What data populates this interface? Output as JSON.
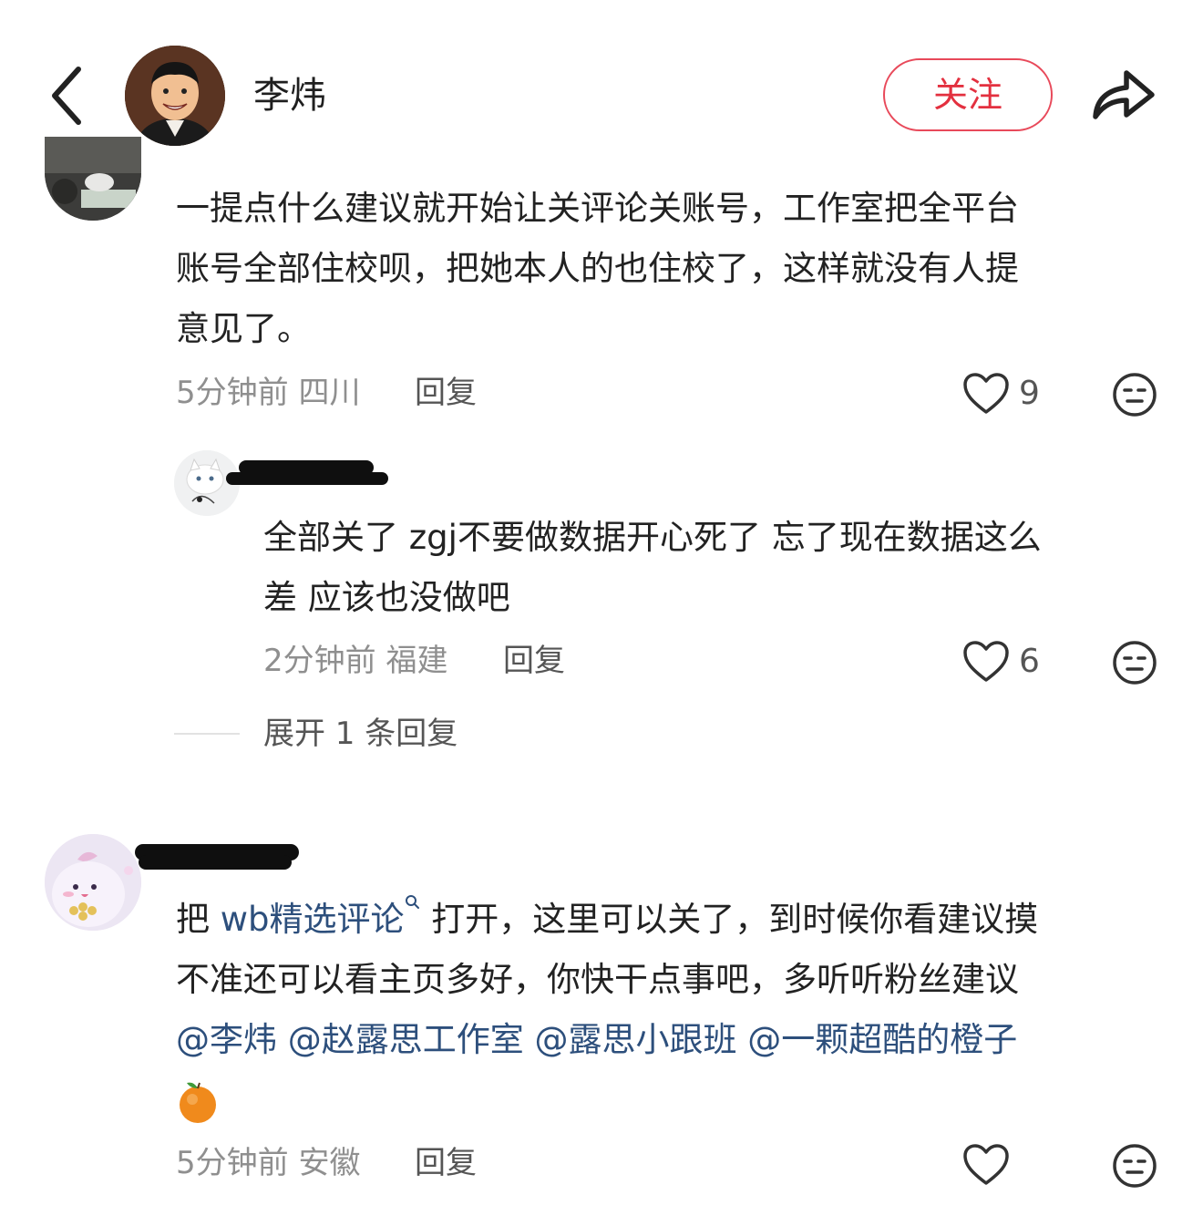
{
  "header": {
    "author_name": "李炜",
    "follow_label": "关注"
  },
  "comments": [
    {
      "text_lines": [
        "一提点什么建议就开始让关评论关账号，工作室把全平台",
        "账号全部住校呗，把她本人的也住校了，这样就没有人提",
        "意见了。"
      ],
      "time": "5分钟前",
      "location": "四川",
      "reply_label": "回复",
      "likes": "9",
      "reply": {
        "text_lines": [
          "全部关了 zgj不要做数据开心死了 忘了现在数据这么",
          "差 应该也没做吧"
        ],
        "time": "2分钟前",
        "location": "福建",
        "reply_label": "回复",
        "likes": "6"
      },
      "expand_label": "展开 1 条回复"
    },
    {
      "line1_prefix": "把 ",
      "link_text": "wb精选评论",
      "line1_suffix": " 打开，这里可以关了，到时候你看建议摸",
      "line2": "不准还可以看主页多好，你快干点事吧，多听听粉丝建议",
      "mentions": [
        "@李炜",
        "@赵露思工作室",
        "@露思小跟班",
        "@一颗超酷的橙子"
      ],
      "emoji_name": "orange-emoji",
      "time": "5分钟前",
      "location": "安徽",
      "reply_label": "回复"
    }
  ],
  "colors": {
    "accent": "#e3303f",
    "mention": "#2d4f7c",
    "meta": "#8f8f8f"
  }
}
